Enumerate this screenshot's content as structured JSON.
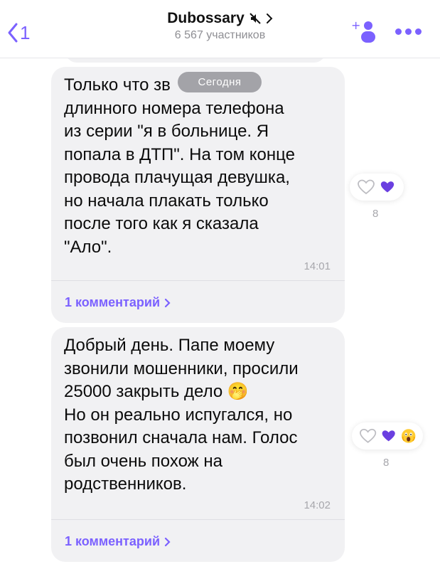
{
  "header": {
    "back_count": "1",
    "title": "Dubossary",
    "subtitle": "6 567 участников",
    "muted": true,
    "accent": "#7b61ff"
  },
  "date_separator": "Сегодня",
  "messages": [
    {
      "text": "Только что зв\nдлинного номера телефона\nиз серии \"я в больнице. Я\nпопала в ДТП\". На том конце\nпровода плачущая девушка,\nно начала плакать только\nпосле того как я сказала\n\"Ало\".",
      "time": "14:01",
      "comments": "1 комментарий",
      "reactions": [
        "heart-outline-icon",
        "purple-heart-icon"
      ],
      "reaction_count": "8"
    },
    {
      "text": "Добрый день. Папе моему\nзвонили мошенники, просили\n25000 закрыть дело 🤭\nНо он реально испугался, но\nпозвонил сначала нам. Голос\nбыл очень похож на\nродственников.",
      "time": "14:02",
      "comments": "1 комментарий",
      "reactions": [
        "heart-outline-icon",
        "purple-heart-icon",
        "scream-emoji-icon"
      ],
      "reaction_count": "8"
    }
  ],
  "colors": {
    "bubble": "#f1f1f3",
    "meta_text": "#a7a7ac",
    "date_pill": "#a3a3a8"
  }
}
